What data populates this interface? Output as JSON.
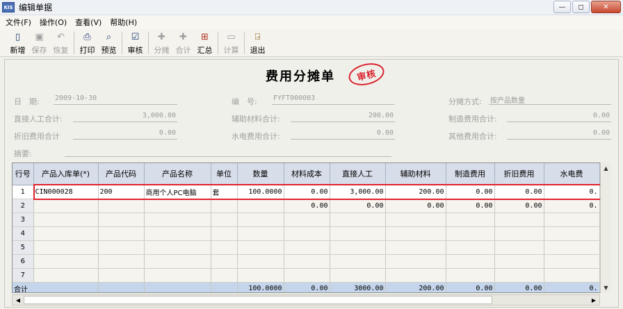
{
  "window": {
    "title": "编辑单据",
    "app_icon": "KIS"
  },
  "menu": [
    {
      "label": "文件(F)"
    },
    {
      "label": "操作(O)"
    },
    {
      "label": "查看(V)"
    },
    {
      "label": "帮助(H)"
    }
  ],
  "toolbar": {
    "new": "新增",
    "save": "保存",
    "restore": "恢复",
    "print": "打印",
    "preview": "预览",
    "audit": "审核",
    "allocate": "分摊",
    "total": "合计",
    "summary": "汇总",
    "calc": "计算",
    "exit": "退出"
  },
  "doc": {
    "title": "费用分摊单",
    "stamp": "审核"
  },
  "fields": {
    "date_label": "日　期:",
    "date": "2009-10-30",
    "number_label": "编　号:",
    "number": "FYFT000003",
    "method_label": "分摊方式:",
    "method": "按产品数量",
    "labor_label": "直接人工合计:",
    "labor": "3,000.00",
    "material_label": "辅助材料合计:",
    "material": "200.00",
    "mfg_label": "制造费用合计:",
    "mfg": "0.00",
    "depr_label": "折旧费用合计",
    "depr": "0.00",
    "utility_label": "水电费用合计:",
    "utility": "0.00",
    "other_label": "其他费用合计:",
    "other": "0.00",
    "memo_label": "摘要:"
  },
  "table": {
    "headers": [
      "行号",
      "产品入库单(*)",
      "产品代码",
      "产品名称",
      "单位",
      "数量",
      "材料成本",
      "直接人工",
      "辅助材料",
      "制造费用",
      "折旧费用",
      "水电费"
    ],
    "rows": [
      [
        "1",
        "CIN000028",
        "200",
        "商用个人PC电脑",
        "套",
        "100.0000",
        "0.00",
        "3,000.00",
        "200.00",
        "0.00",
        "0.00",
        "0."
      ],
      [
        "2",
        "",
        "",
        "",
        "",
        "",
        "0.00",
        "0.00",
        "0.00",
        "0.00",
        "0.00",
        "0."
      ],
      [
        "3",
        "",
        "",
        "",
        "",
        "",
        "",
        "",
        "",
        "",
        "",
        ""
      ],
      [
        "4",
        "",
        "",
        "",
        "",
        "",
        "",
        "",
        "",
        "",
        "",
        ""
      ],
      [
        "5",
        "",
        "",
        "",
        "",
        "",
        "",
        "",
        "",
        "",
        "",
        ""
      ],
      [
        "6",
        "",
        "",
        "",
        "",
        "",
        "",
        "",
        "",
        "",
        "",
        ""
      ],
      [
        "7",
        "",
        "",
        "",
        "",
        "",
        "",
        "",
        "",
        "",
        "",
        ""
      ]
    ],
    "total": [
      "合计",
      "",
      "",
      "",
      "",
      "100.0000",
      "0.00",
      "3000.00",
      "200.00",
      "0.00",
      "0.00",
      "0."
    ]
  },
  "colors": {
    "highlight": "#e0202c",
    "stamp": "#d9232e",
    "header_bg": "#d7dde9",
    "total_bg": "#c5d6ec"
  }
}
